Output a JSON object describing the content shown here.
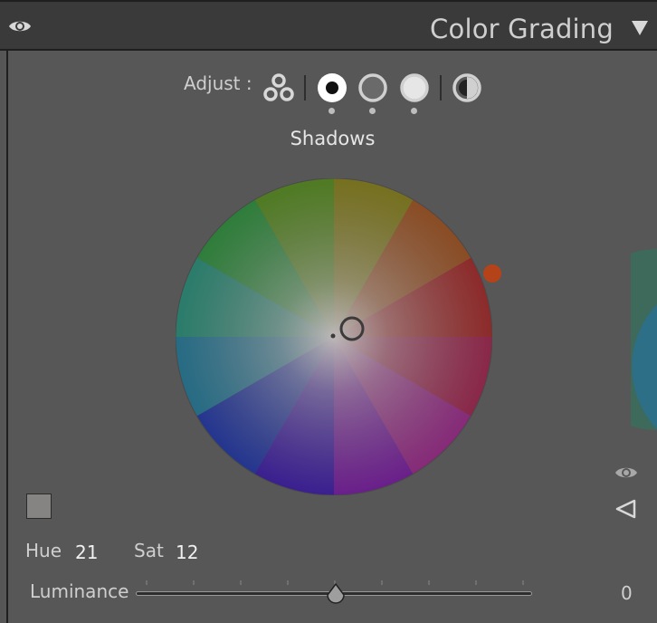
{
  "header": {
    "title": "Color Grading",
    "visibility_icon": "eye-icon",
    "collapse_icon": "triangle-down-icon"
  },
  "adjust": {
    "label": "Adjust :",
    "modes": [
      {
        "icon": "three-way-icon"
      },
      {
        "icon": "shadows-icon",
        "selected": true
      },
      {
        "icon": "midtones-icon"
      },
      {
        "icon": "highlights-icon"
      },
      {
        "icon": "global-icon"
      }
    ]
  },
  "section": {
    "label": "Shadows"
  },
  "wheel": {
    "handle_color": "#b4431a"
  },
  "swatch": {
    "color": "#868383"
  },
  "controls": {
    "hue_label": "Hue",
    "hue_value": "21",
    "sat_label": "Sat",
    "sat_value": "12",
    "luminance_label": "Luminance",
    "luminance_value": "0"
  },
  "colors": {
    "panel_bg": "#575757",
    "header_bg": "#3a3a3a",
    "accent_handle": "#b4431a"
  }
}
